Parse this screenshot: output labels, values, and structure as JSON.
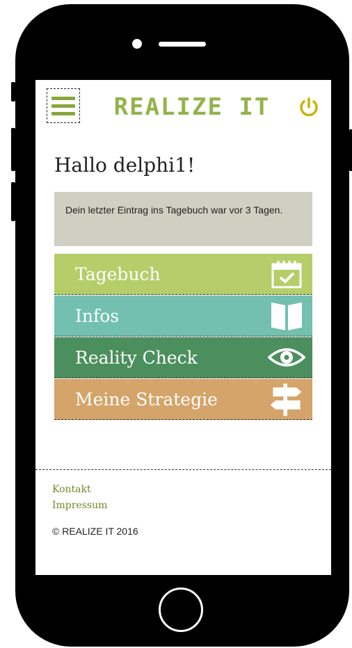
{
  "header": {
    "logo_text": "REALIZE IT",
    "menu_icon": "hamburger-menu-icon",
    "power_icon": "power-icon",
    "accent": "#93b34a"
  },
  "greeting": "Hallo delphi1!",
  "notice": "Dein letzter Eintrag ins Tagebuch war vor 3 Tagen.",
  "tiles": [
    {
      "label": "Tagebuch",
      "icon": "calendar-check-icon",
      "color": "#b5ce6a"
    },
    {
      "label": "Infos",
      "icon": "book-icon",
      "color": "#73c0b0"
    },
    {
      "label": "Reality Check",
      "icon": "eye-icon",
      "color": "#4c8f5e"
    },
    {
      "label": "Meine Strategie",
      "icon": "signpost-icon",
      "color": "#d4a46a"
    }
  ],
  "footer": {
    "links": [
      "Kontakt",
      "Impressum"
    ],
    "copyright": "© REALIZE IT 2016"
  }
}
